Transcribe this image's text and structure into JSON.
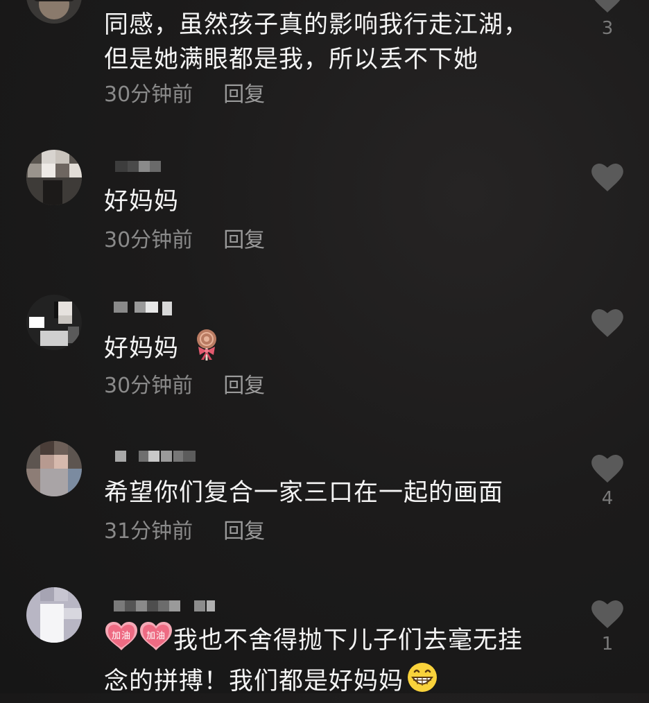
{
  "comments": [
    {
      "text_lines": [
        "同感，虽然孩子真的影响我行走江湖，",
        "但是她满眼都是我，所以丢不下她"
      ],
      "time": "30分钟前",
      "reply": "回复",
      "likes": "3"
    },
    {
      "text_lines": [
        "好妈妈"
      ],
      "time": "30分钟前",
      "reply": "回复",
      "likes": ""
    },
    {
      "text_lines": [
        "好妈妈"
      ],
      "emoji": "lollipop-bow-icon",
      "time": "30分钟前",
      "reply": "回复",
      "likes": ""
    },
    {
      "text_lines": [
        "希望你们复合一家三口在一起的画面"
      ],
      "time": "31分钟前",
      "reply": "回复",
      "likes": "4"
    },
    {
      "prefix_stickers": [
        "加油",
        "加油"
      ],
      "text_lines": [
        "我也不舍得抛下儿子们去毫无挂",
        "念的拼搏！我们都是好妈妈"
      ],
      "suffix_emoji": "grinning-face-icon",
      "time": "",
      "reply": "",
      "likes": "1"
    }
  ],
  "colors": {
    "background": "#1c1b1b",
    "text": "#f4f4f4",
    "meta": "#8a8a8a",
    "heart": "#5a5a5a"
  }
}
